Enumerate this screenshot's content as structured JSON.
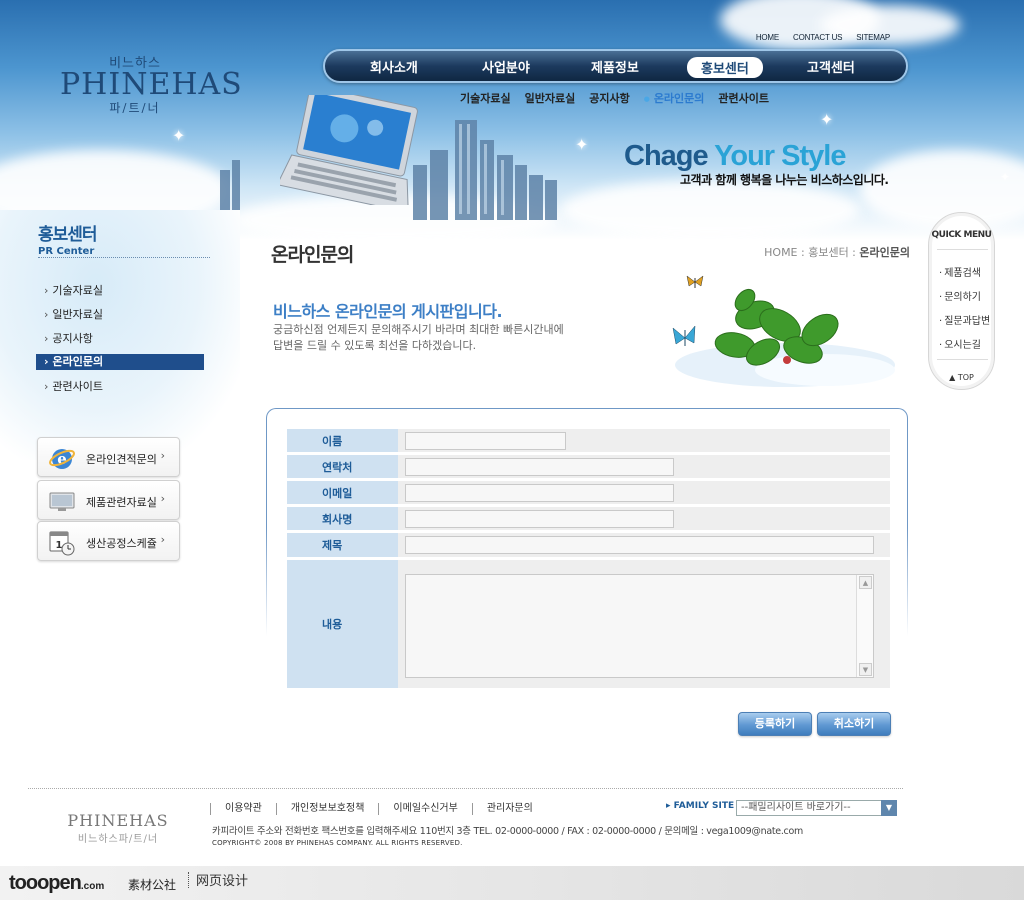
{
  "header": {
    "logo": {
      "kr_top": "비느하스",
      "en": "PHINEHAS",
      "kr_bottom": "파/트/너"
    },
    "util_links": [
      "HOME",
      "CONTACT US",
      "SITEMAP"
    ],
    "gnb": [
      "회사소개",
      "사업분야",
      "제품정보",
      "홍보센터",
      "고객센터"
    ],
    "gnb_active": "홍보센터",
    "sub_nav": [
      "기술자료실",
      "일반자료실",
      "공지사항",
      "온라인문의",
      "관련사이트"
    ],
    "slogan": {
      "part1": "Chage ",
      "part2": "Your Style",
      "sub": "고객과 함께 행복을 나누는 비스하스입니다."
    }
  },
  "sidebar": {
    "title_kr": "홍보센터",
    "title_en": "PR Center",
    "menu": [
      "기술자료실",
      "일반자료실",
      "공지사항",
      "온라인문의",
      "관련사이트"
    ],
    "active": "온라인문의",
    "quick_buttons": [
      "온라인견적문의",
      "제품관련자료실",
      "생산공정스케쥴"
    ]
  },
  "quick_menu": {
    "title": "QUICK MENU",
    "items": [
      "제품검색",
      "문의하기",
      "질문과답변",
      "오시는길"
    ],
    "top": "TOP"
  },
  "content": {
    "page_title": "온라인문의",
    "breadcrumb": {
      "path": "HOME : 홍보센터 : ",
      "current": "온라인문의"
    },
    "intro_heading": "비느하스 온라인문의 게시판입니다.",
    "intro_line1": "궁금하신점 언제든지 문의해주시기 바라며 최대한 빠른시간내에",
    "intro_line2": "답변을 드릴 수 있도록 최선을 다하겠습니다."
  },
  "form": {
    "labels": {
      "name": "이름",
      "contact": "연락처",
      "email": "이메일",
      "company": "회사명",
      "subject": "제목",
      "body": "내용"
    },
    "values": {
      "name": "",
      "contact": "",
      "email": "",
      "company": "",
      "subject": "",
      "body": ""
    },
    "submit": "등록하기",
    "cancel": "취소하기"
  },
  "footer": {
    "logo_en": "PHINEHAS",
    "logo_kr": "비느하스파/트/너",
    "links": [
      "이용약관",
      "개인정보보호정책",
      "이메일수신거부",
      "관리자문의"
    ],
    "address": "카피라이트 주소와 전화번호 팩스번호를 입력해주세요 110번지 3층   TEL. 02-0000-0000 / FAX : 02-0000-0000  / 문의메일 : vega1009@nate.com",
    "copyright": "COPYRIGHT© 2008 BY PHINEHAS COMPANY. ALL RIGHTS RESERVED.",
    "family_site_label": "FAMILY SITE",
    "family_site_select": "--패밀리사이트 바로가기--"
  },
  "watermark": {
    "brand": "tooopen",
    "domain": ".com",
    "cn1": "素材公社",
    "cn2": "网页设计"
  },
  "colors": {
    "accent": "#1e5c98",
    "nav_dark": "#1c3a5e",
    "label_bg": "#cfe1f1",
    "button_blue": "#5f98d2"
  }
}
